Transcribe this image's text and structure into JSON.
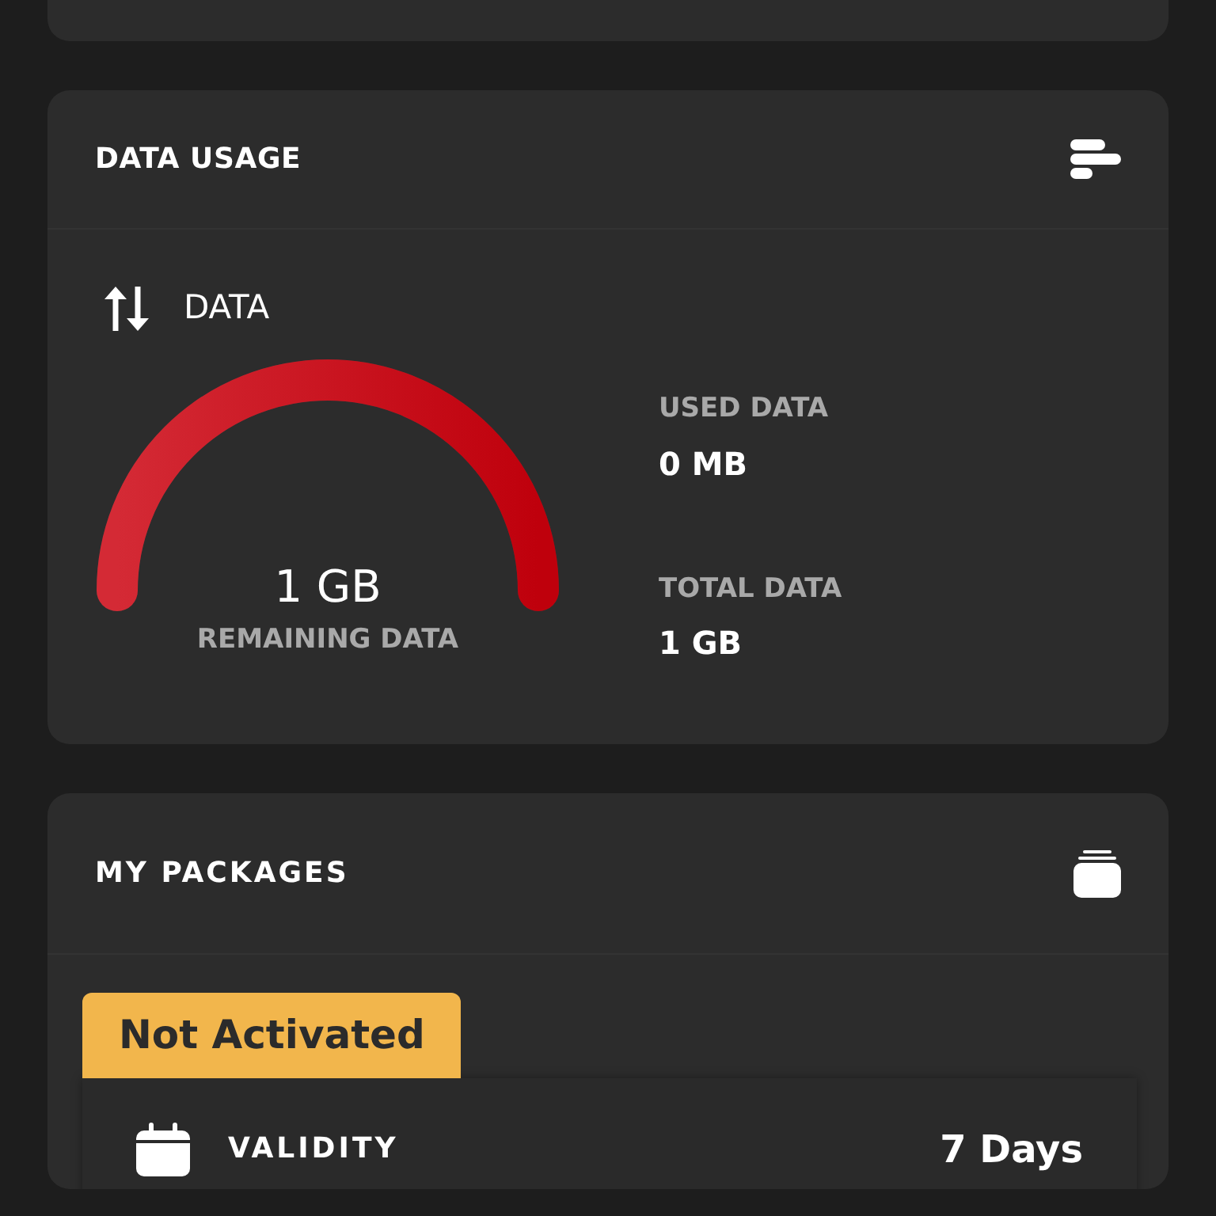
{
  "data_usage": {
    "title": "DATA USAGE",
    "section": "DATA",
    "gauge": {
      "level": 1,
      "value": "1 GB",
      "label": "REMAINING DATA"
    },
    "stats": [
      {
        "label": "USED DATA",
        "value": "0 MB"
      },
      {
        "label": "TOTAL DATA",
        "value": "1 GB"
      }
    ]
  },
  "packages": {
    "title": "MY PACKAGES",
    "status": "Not Activated",
    "rows": [
      {
        "label": "VALIDITY",
        "value": "7 Days"
      }
    ]
  }
}
